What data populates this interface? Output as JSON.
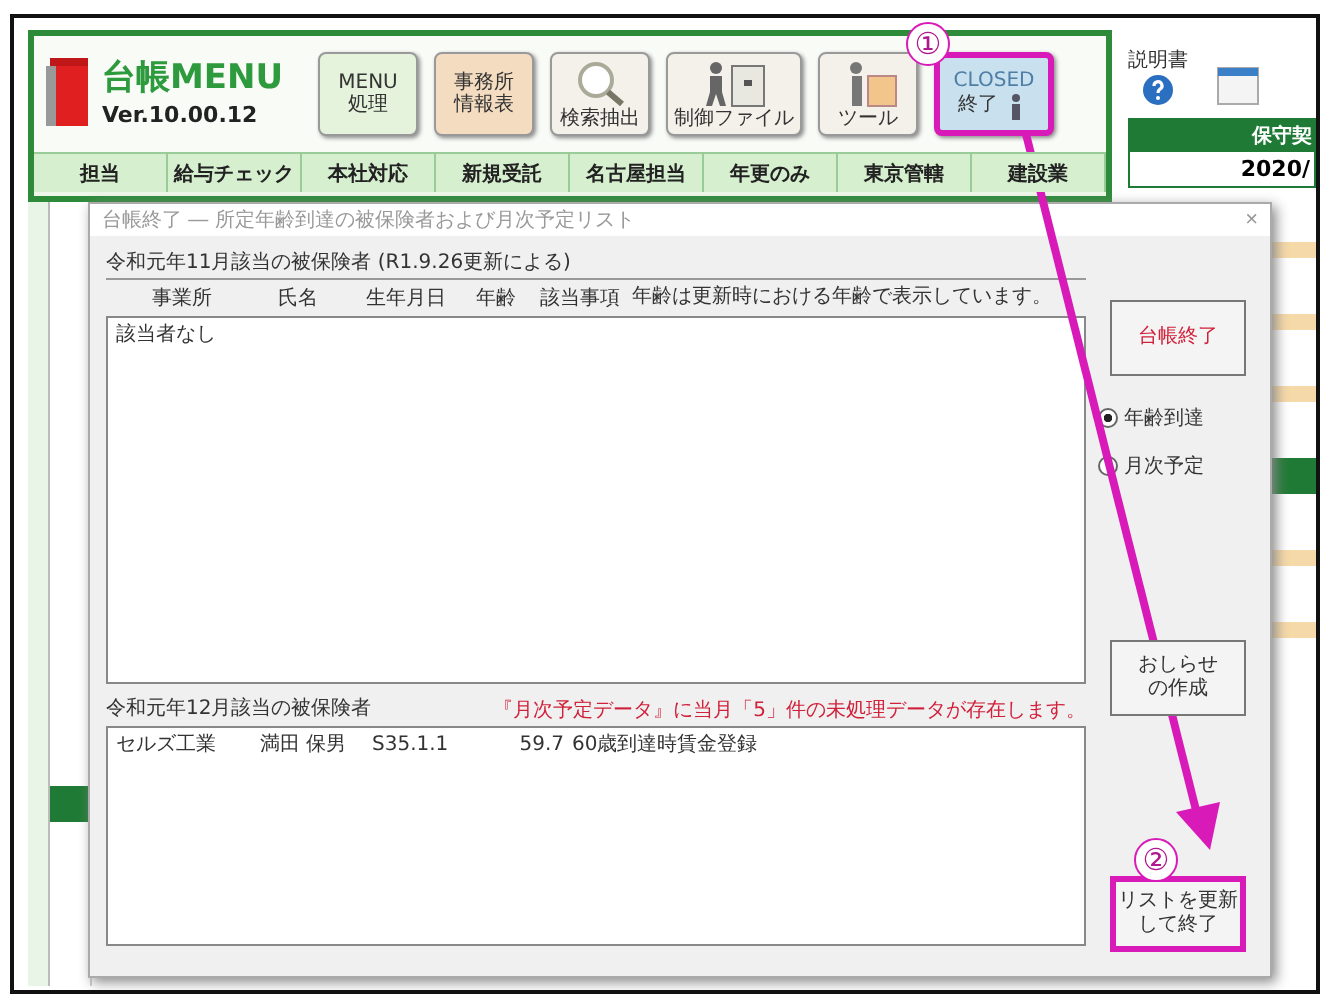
{
  "app": {
    "title": "台帳MENU",
    "version": "Ver.10.00.12"
  },
  "toolbar": [
    {
      "kind": "text",
      "lines": [
        "MENU",
        "処理"
      ],
      "color": "#e6f3dc",
      "highlighted": false
    },
    {
      "kind": "text",
      "lines": [
        "事務所",
        "情報表"
      ],
      "color": "#f3dcc0",
      "highlighted": false
    },
    {
      "kind": "search",
      "caption": "検索抽出",
      "highlighted": false
    },
    {
      "kind": "files",
      "caption": "制御ファイル",
      "highlighted": false
    },
    {
      "kind": "tools",
      "caption": "ツール",
      "highlighted": false
    },
    {
      "kind": "close",
      "lines": [
        "CLOSED",
        "終了"
      ],
      "highlighted": true
    }
  ],
  "tabs": [
    "担当",
    "給与チェック",
    "本社対応",
    "新規受託",
    "名古屋担当",
    "年更のみ",
    "東京管轄",
    "建設業"
  ],
  "side": {
    "manual_label": "説明書",
    "banner": "保守契",
    "date": "2020/"
  },
  "dialog": {
    "title": "台帳終了 ― 所定年齢到達の被保険者および月次予定リスト",
    "close": "×",
    "group1": {
      "legend": "令和元年11月該当の被保険者 (R1.9.26更新による)",
      "columns": [
        "事業所",
        "氏名",
        "生年月日",
        "年齢",
        "該当事項"
      ],
      "note": "年齢は更新時における年齢で表示しています。",
      "empty": "該当者なし"
    },
    "finish_button": "台帳終了",
    "radios": [
      {
        "label": "年齢到達",
        "selected": true
      },
      {
        "label": "月次予定",
        "selected": false
      }
    ],
    "notice_button": [
      "おしらせ",
      "の作成"
    ],
    "group2": {
      "legend": "令和元年12月該当の被保険者",
      "warning": "『月次予定データ』に当月「5」件の未処理データが存在します。",
      "rows": [
        {
          "cells": [
            "セルズ工業",
            "満田 保男",
            "S35.1.1",
            "59.7",
            "60歳到達時賃金登録"
          ]
        }
      ]
    },
    "update_button": {
      "lines": [
        "リストを更新",
        "して終了"
      ],
      "highlighted": true
    }
  },
  "annotations": [
    {
      "label": "①"
    },
    {
      "label": "②"
    }
  ]
}
